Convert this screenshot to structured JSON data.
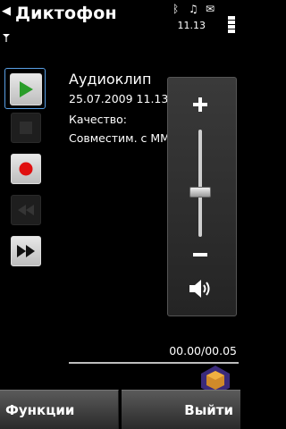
{
  "status": {
    "app_title": "Диктофон",
    "clock": "11.13"
  },
  "controls": [
    {
      "name": "play",
      "state": "active"
    },
    {
      "name": "stop",
      "state": "disabled"
    },
    {
      "name": "record",
      "state": "active"
    },
    {
      "name": "rewind",
      "state": "disabled"
    },
    {
      "name": "fast-forward",
      "state": "active"
    }
  ],
  "clip": {
    "title": "Аудиоклип",
    "date": "25.07.2009 11.13",
    "quality_label": "Качество:",
    "quality_value": "Совместим. с ММ"
  },
  "volume": {
    "level": 0.45,
    "icons": [
      "plus-icon",
      "minus-icon",
      "speaker-icon"
    ]
  },
  "playback": {
    "time": "00.00/00.05",
    "progress": 0
  },
  "softkeys": {
    "left": "Функции",
    "right": "Выйти"
  },
  "colors": {
    "play_green": "#2a9d2a",
    "record_red": "#e01010",
    "focus_blue": "#5aa0e6"
  }
}
